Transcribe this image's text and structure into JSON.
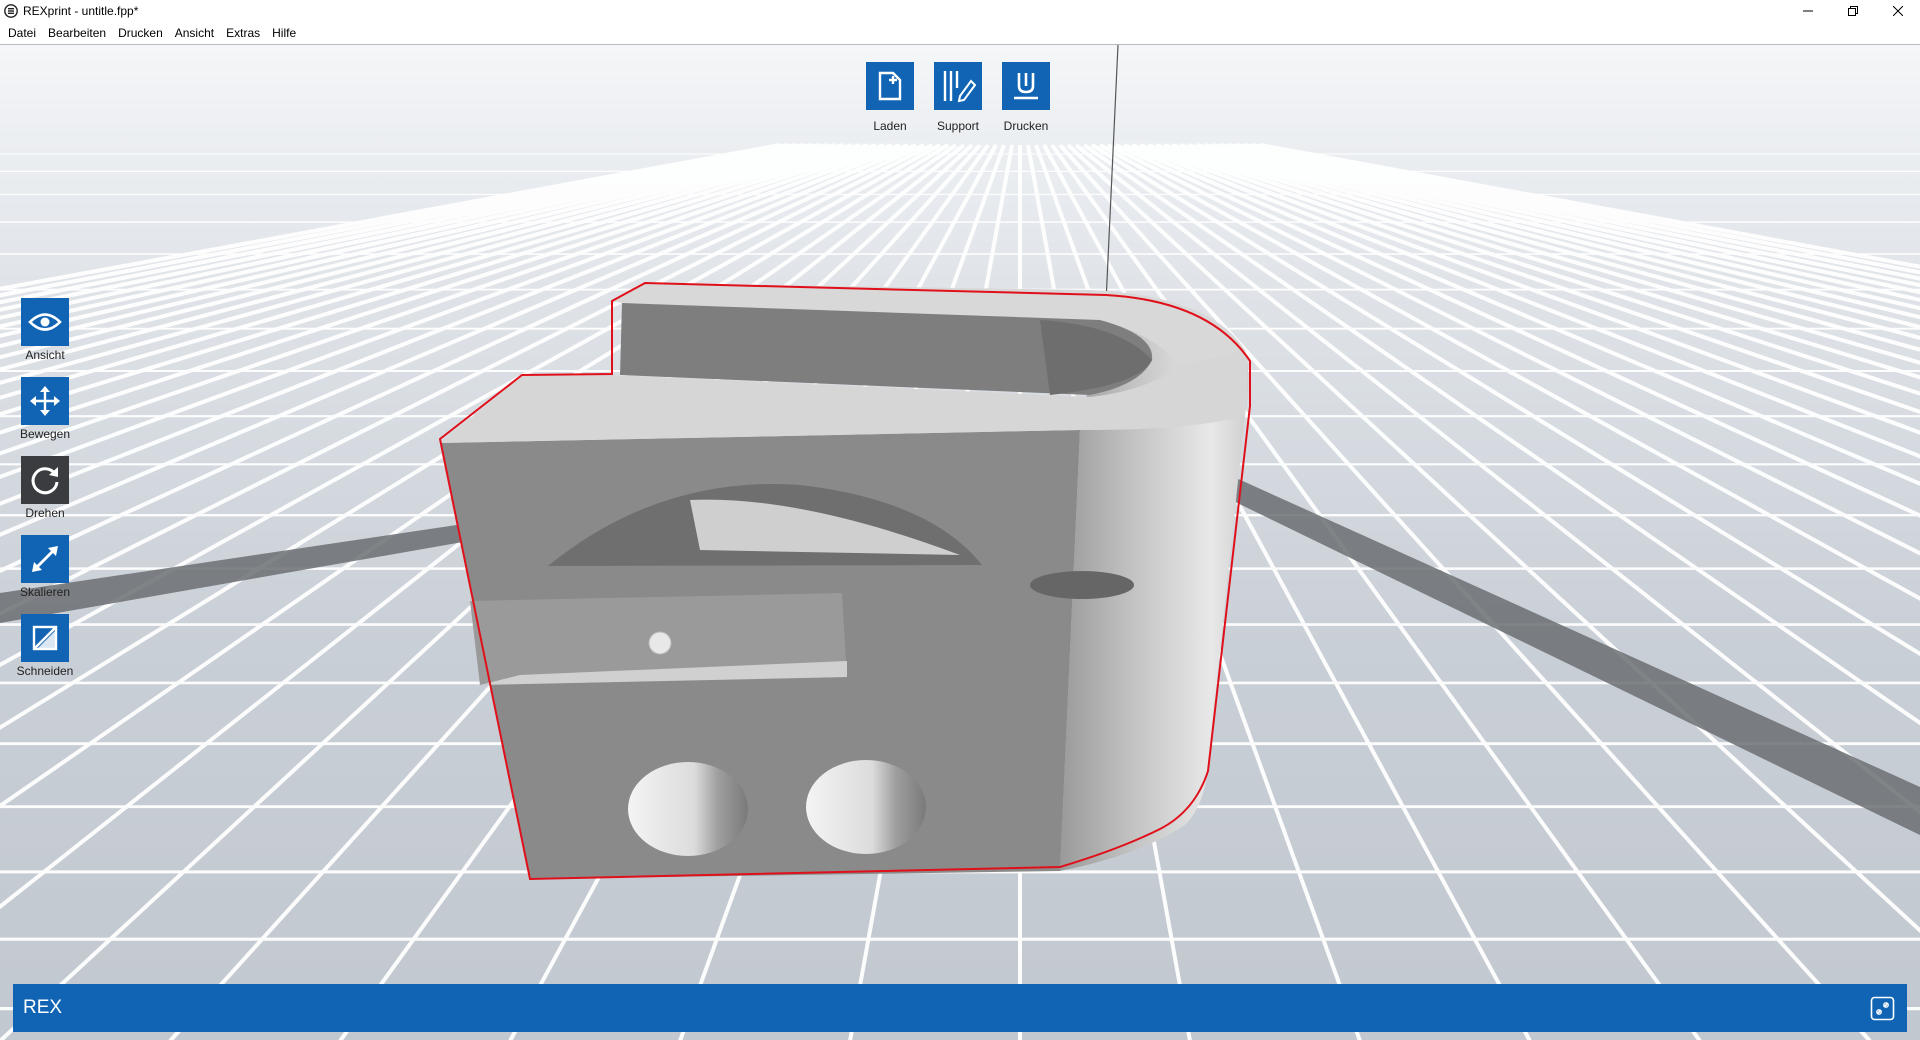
{
  "window": {
    "title": "REXprint - untitle.fpp*",
    "app_icon": "rexprint-logo-icon",
    "controls": [
      "minimize-icon",
      "restore-icon",
      "close-icon"
    ]
  },
  "menu": {
    "items": [
      "Datei",
      "Bearbeiten",
      "Drucken",
      "Ansicht",
      "Extras",
      "Hilfe"
    ]
  },
  "top_toolbar": {
    "items": [
      {
        "label": "Laden",
        "icon": "load-file-icon"
      },
      {
        "label": "Support",
        "icon": "support-edit-icon"
      },
      {
        "label": "Drucken",
        "icon": "print-nozzle-icon"
      }
    ]
  },
  "left_toolbar": {
    "items": [
      {
        "label": "Ansicht",
        "icon": "eye-icon"
      },
      {
        "label": "Bewegen",
        "icon": "move-arrows-icon"
      },
      {
        "label": "Drehen",
        "icon": "rotate-icon",
        "active": true
      },
      {
        "label": "Skalieren",
        "icon": "scale-diagonal-icon"
      },
      {
        "label": "Schneiden",
        "icon": "cut-icon"
      }
    ]
  },
  "statusbar": {
    "text": "REX",
    "icon": "link-settings-icon"
  },
  "colors": {
    "accent": "#1164b4",
    "dark_tool": "#3a3c40",
    "model_outline": "#e0101a",
    "grid_line": "#ffffff",
    "floor": "#c9cfd6"
  }
}
